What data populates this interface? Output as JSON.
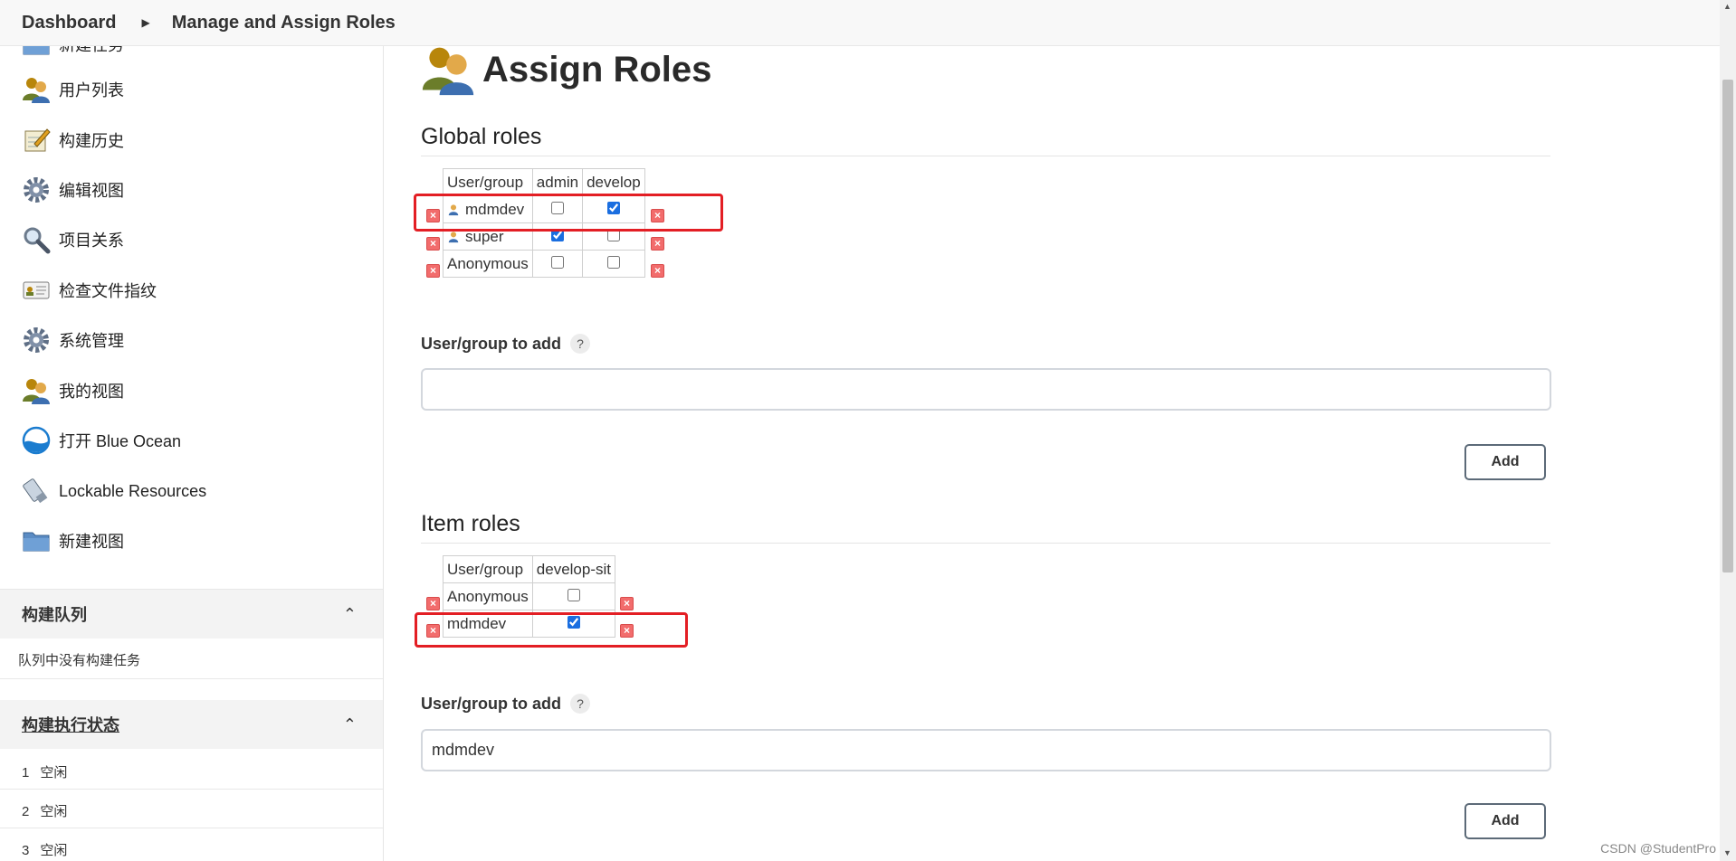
{
  "breadcrumb": {
    "home": "Dashboard",
    "current": "Manage and Assign Roles"
  },
  "sidebar": {
    "partial_item": "新建任务",
    "items": [
      {
        "label": "用户列表",
        "icon": "users-icon"
      },
      {
        "label": "构建历史",
        "icon": "notepad-icon"
      },
      {
        "label": "编辑视图",
        "icon": "gear-icon"
      },
      {
        "label": "项目关系",
        "icon": "magnifier-icon"
      },
      {
        "label": "检查文件指纹",
        "icon": "fingerprint-card-icon"
      },
      {
        "label": "系统管理",
        "icon": "gear-icon"
      },
      {
        "label": "我的视图",
        "icon": "users-icon"
      },
      {
        "label": "打开 Blue Ocean",
        "icon": "blue-ocean-icon"
      },
      {
        "label": "Lockable Resources",
        "icon": "usb-key-icon"
      },
      {
        "label": "新建视图",
        "icon": "folder-icon"
      }
    ],
    "build_queue": {
      "title": "构建队列",
      "empty_text": "队列中没有构建任务"
    },
    "executors": {
      "title": "构建执行状态",
      "rows": [
        {
          "num": "1",
          "status": "空闲"
        },
        {
          "num": "2",
          "status": "空闲"
        },
        {
          "num": "3",
          "status": "空闲"
        }
      ]
    }
  },
  "main": {
    "title": "Assign Roles",
    "global": {
      "heading": "Global roles",
      "columns": [
        "User/group",
        "admin",
        "develop"
      ],
      "rows": [
        {
          "name": "mdmdev",
          "user_icon": true,
          "checks": [
            false,
            true
          ]
        },
        {
          "name": "super",
          "user_icon": true,
          "checks": [
            true,
            false
          ]
        },
        {
          "name": "Anonymous",
          "user_icon": false,
          "checks": [
            false,
            false
          ]
        }
      ],
      "add_label": "User/group to add",
      "help": "?",
      "input_value": "",
      "add_button": "Add"
    },
    "item": {
      "heading": "Item roles",
      "columns": [
        "User/group",
        "develop-sit"
      ],
      "rows": [
        {
          "name": "Anonymous",
          "user_icon": false,
          "checks": [
            false
          ]
        },
        {
          "name": "mdmdev",
          "user_icon": false,
          "checks": [
            true
          ]
        }
      ],
      "add_label": "User/group to add",
      "help": "?",
      "input_value": "mdmdev",
      "add_button": "Add"
    }
  },
  "watermark": "CSDN @StudentPro",
  "colors": {
    "highlight": "#e31e24",
    "checkbox": "#1a6ee0",
    "delete": "#f26c6c"
  }
}
